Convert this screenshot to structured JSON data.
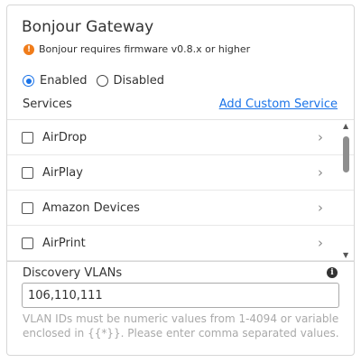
{
  "panel": {
    "title": "Bonjour Gateway",
    "warning": "Bonjour requires firmware v0.8.x or higher",
    "warning_icon": "!",
    "accent_color": "#1a73e8",
    "warning_color": "#f07c1a"
  },
  "mode": {
    "enabled_label": "Enabled",
    "disabled_label": "Disabled",
    "selected": "Enabled"
  },
  "services": {
    "label": "Services",
    "add_label": "Add Custom Service",
    "items": [
      {
        "label": "AirDrop"
      },
      {
        "label": "AirPlay"
      },
      {
        "label": "Amazon Devices"
      },
      {
        "label": "AirPrint"
      }
    ]
  },
  "vlans": {
    "label": "Discovery VLANs",
    "info_icon": "i",
    "value": "106,110,111",
    "help": "VLAN IDs must be numeric values from 1-4094 or variable enclosed in {{*}}. Please enter comma separated values."
  }
}
